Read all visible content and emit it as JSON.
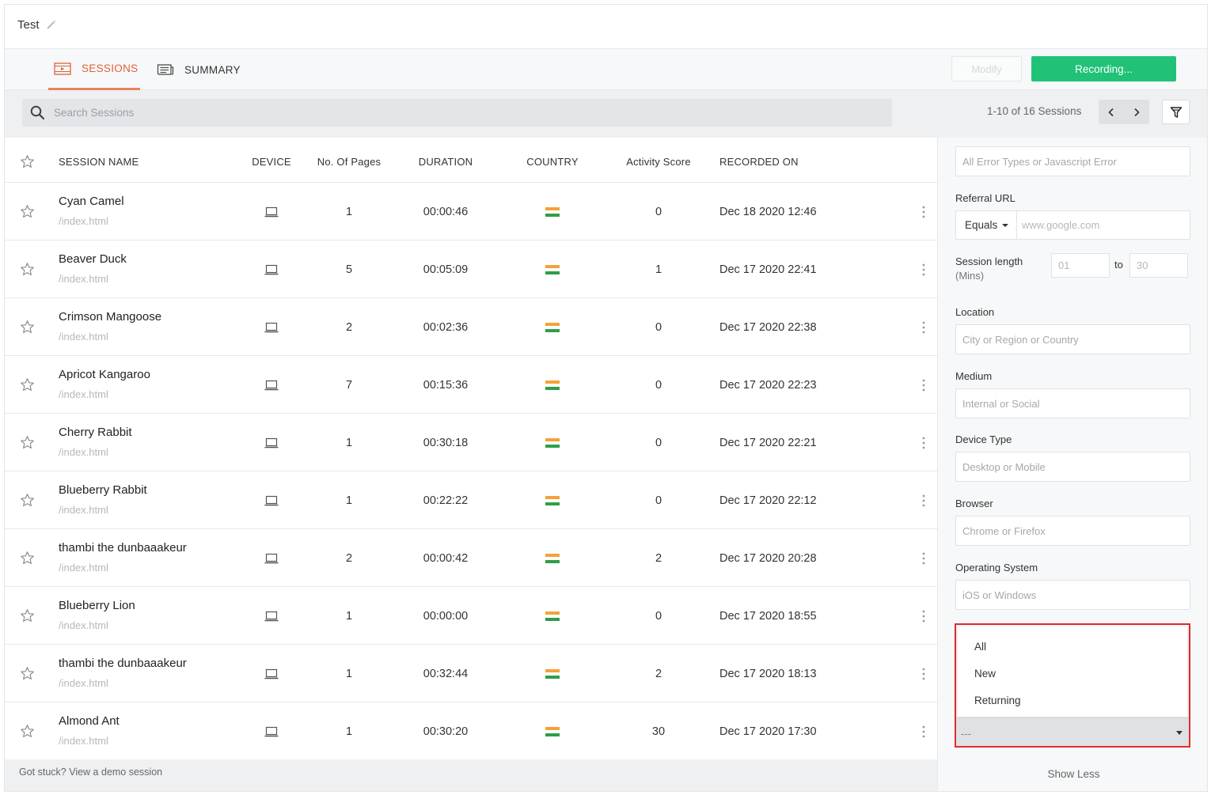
{
  "header": {
    "title": "Test"
  },
  "tabs": [
    {
      "label": "SESSIONS",
      "active": true
    },
    {
      "label": "SUMMARY",
      "active": false
    }
  ],
  "actions": {
    "modify_label": "Modify",
    "recording_label": "Recording..."
  },
  "search": {
    "placeholder": "Search Sessions"
  },
  "pagination": {
    "text": "1-10 of 16 Sessions"
  },
  "table": {
    "headers": {
      "name": "SESSION NAME",
      "device": "DEVICE",
      "pages": "No. Of Pages",
      "duration": "DURATION",
      "country": "COUNTRY",
      "score": "Activity Score",
      "recorded": "RECORDED ON"
    },
    "rows": [
      {
        "name": "Cyan Camel",
        "url": "/index.html",
        "pages": "1",
        "duration": "00:00:46",
        "score": "0",
        "recorded": "Dec 18 2020 12:46"
      },
      {
        "name": "Beaver Duck",
        "url": "/index.html",
        "pages": "5",
        "duration": "00:05:09",
        "score": "1",
        "recorded": "Dec 17 2020 22:41"
      },
      {
        "name": "Crimson Mangoose",
        "url": "/index.html",
        "pages": "2",
        "duration": "00:02:36",
        "score": "0",
        "recorded": "Dec 17 2020 22:38"
      },
      {
        "name": "Apricot Kangaroo",
        "url": "/index.html",
        "pages": "7",
        "duration": "00:15:36",
        "score": "0",
        "recorded": "Dec 17 2020 22:23"
      },
      {
        "name": "Cherry Rabbit",
        "url": "/index.html",
        "pages": "1",
        "duration": "00:30:18",
        "score": "0",
        "recorded": "Dec 17 2020 22:21"
      },
      {
        "name": "Blueberry Rabbit",
        "url": "/index.html",
        "pages": "1",
        "duration": "00:22:22",
        "score": "0",
        "recorded": "Dec 17 2020 22:12"
      },
      {
        "name": "thambi the dunbaaakeur",
        "url": "/index.html",
        "pages": "2",
        "duration": "00:00:42",
        "score": "2",
        "recorded": "Dec 17 2020 20:28"
      },
      {
        "name": "Blueberry Lion",
        "url": "/index.html",
        "pages": "1",
        "duration": "00:00:00",
        "score": "0",
        "recorded": "Dec 17 2020 18:55"
      },
      {
        "name": "thambi the dunbaaakeur",
        "url": "/index.html",
        "pages": "1",
        "duration": "00:32:44",
        "score": "2",
        "recorded": "Dec 17 2020 18:13"
      },
      {
        "name": "Almond Ant",
        "url": "/index.html",
        "pages": "1",
        "duration": "00:30:20",
        "score": "30",
        "recorded": "Dec 17 2020 17:30"
      }
    ]
  },
  "footer": {
    "text": "Got stuck? View a demo session"
  },
  "filters": {
    "error_types_placeholder": "All Error Types or Javascript Error",
    "referral_label": "Referral URL",
    "referral_operator": "Equals",
    "referral_placeholder": "www.google.com",
    "session_length_label": "Session length",
    "session_length_unit": "(Mins)",
    "session_from_placeholder": "01",
    "session_to_label": "to",
    "session_to_placeholder": "30",
    "location_label": "Location",
    "location_placeholder": "City or Region or Country",
    "medium_label": "Medium",
    "medium_placeholder": "Internal or Social",
    "device_label": "Device Type",
    "device_placeholder": "Desktop or Mobile",
    "browser_label": "Browser",
    "browser_placeholder": "Chrome or Firefox",
    "os_label": "Operating System",
    "os_placeholder": "iOS or Windows",
    "visitor_options": [
      "All",
      "New",
      "Returning"
    ],
    "visitor_selected": "---",
    "show_less_label": "Show Less"
  },
  "colors": {
    "accent": "#e2603a",
    "recording": "#21c278",
    "highlight": "#e32b2b"
  }
}
